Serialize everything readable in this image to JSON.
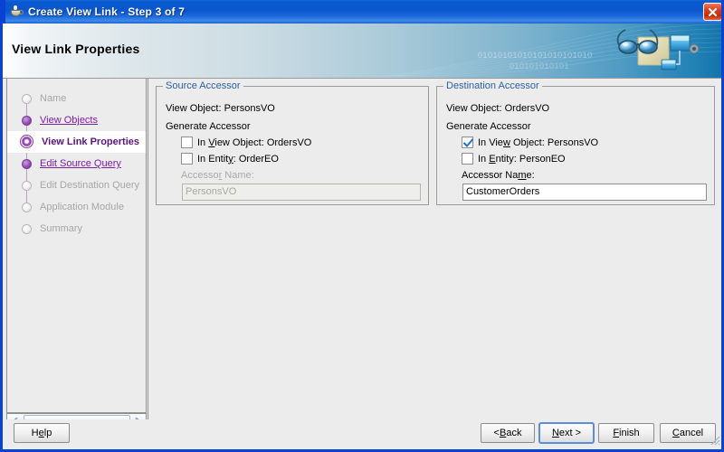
{
  "window": {
    "title": "Create View Link - Step 3 of 7",
    "app_icon": "coffee-cup-icon",
    "close_icon": "close-icon",
    "accent_blue": "#0a42d4",
    "banner_title": "View Link Properties"
  },
  "sidebar": {
    "steps": [
      {
        "label": "Name",
        "state": "pending"
      },
      {
        "label": "View Objects",
        "state": "done"
      },
      {
        "label": "View Link Properties",
        "state": "active"
      },
      {
        "label": "Edit Source Query",
        "state": "done"
      },
      {
        "label": "Edit Destination Query",
        "state": "pending"
      },
      {
        "label": "Application Module",
        "state": "pending"
      },
      {
        "label": "Summary",
        "state": "pending"
      }
    ],
    "scrollbar": {
      "left_arrow_icon": "chevron-left-icon",
      "right_arrow_icon": "chevron-right-icon"
    }
  },
  "source_accessor": {
    "group_title": "Source Accessor",
    "view_object_line": "View Object: PersonsVO",
    "generate_accessor_label": "Generate Accessor",
    "checkbox_view_object": {
      "prefix": "In ",
      "mnemonic": "V",
      "suffix": "iew Object: OrdersVO",
      "checked": false,
      "enabled": true
    },
    "checkbox_entity": {
      "prefix": "In Entit",
      "mnemonic": "y",
      "suffix": ": OrderEO",
      "checked": false,
      "enabled": true
    },
    "accessor_name_label": {
      "prefix": "Accesso",
      "mnemonic": "r",
      "suffix": " Name:",
      "enabled": false
    },
    "accessor_name_value": "PersonsVO",
    "accessor_name_enabled": false
  },
  "destination_accessor": {
    "group_title": "Destination Accessor",
    "view_object_line": "View Object: OrdersVO",
    "generate_accessor_label": "Generate Accessor",
    "checkbox_view_object": {
      "prefix": "In Vie",
      "mnemonic": "w",
      "suffix": " Object: PersonsVO",
      "checked": true,
      "enabled": true
    },
    "checkbox_entity": {
      "prefix": "In ",
      "mnemonic": "E",
      "suffix": "ntity: PersonEO",
      "checked": false,
      "enabled": true
    },
    "accessor_name_label": {
      "prefix": "Accessor Na",
      "mnemonic": "m",
      "suffix": "e:",
      "enabled": true
    },
    "accessor_name_value": "CustomerOrders",
    "accessor_name_enabled": true
  },
  "footer": {
    "help": {
      "prefix": "H",
      "mnemonic": "e",
      "suffix": "lp"
    },
    "back": {
      "prefix": "< ",
      "mnemonic": "B",
      "suffix": "ack"
    },
    "next": {
      "prefix": "",
      "mnemonic": "N",
      "suffix": "ext >",
      "default": true
    },
    "finish": {
      "prefix": "",
      "mnemonic": "F",
      "suffix": "inish"
    },
    "cancel": {
      "prefix": "",
      "mnemonic": "C",
      "suffix": "ancel"
    }
  },
  "banner_decoration": {
    "binary_line_1": "01010101010101010101010",
    "binary_line_2": "010101010101",
    "art": "glasses-document-diagram-graphic"
  }
}
